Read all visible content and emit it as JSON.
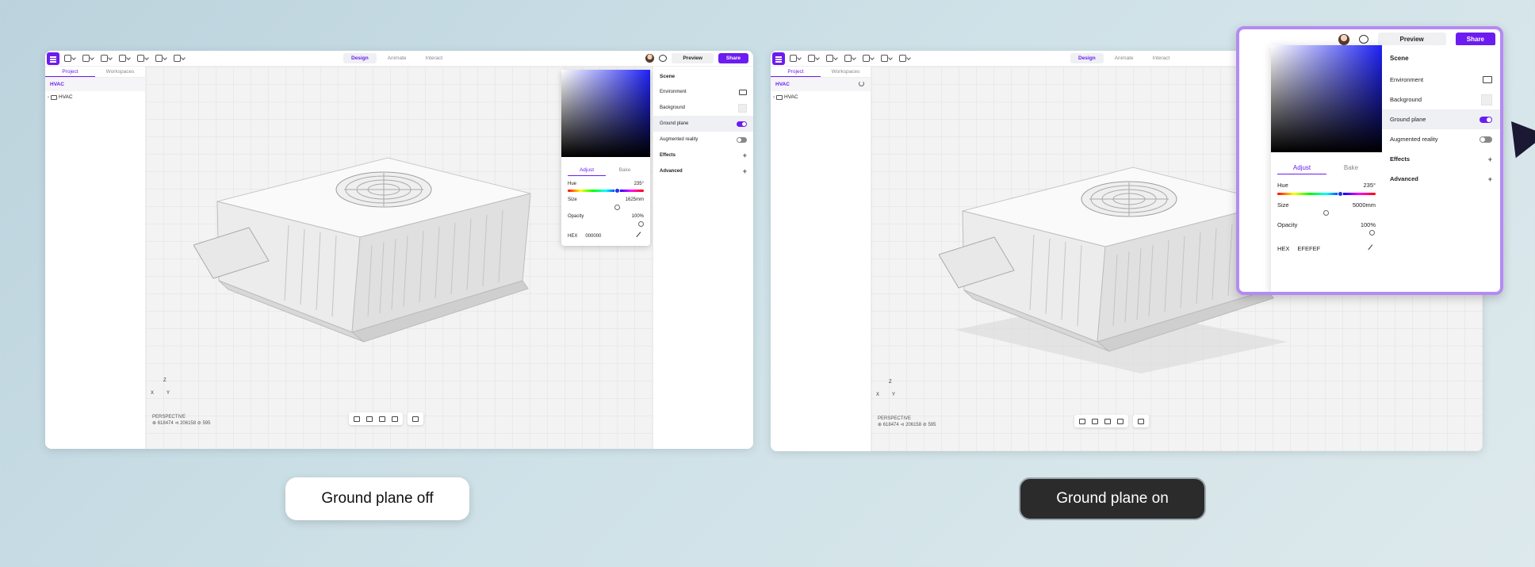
{
  "colors": {
    "accent": "#6c1cf0",
    "zoom_border": "#b48af4",
    "caption_dark": "#2b2b2b"
  },
  "left_window": {
    "toolbar": {
      "modes": [
        "Design",
        "Animate",
        "Interact"
      ],
      "active_mode": "Design",
      "preview_label": "Preview",
      "share_label": "Share"
    },
    "left_panel": {
      "tabs": [
        "Project",
        "Workspaces"
      ],
      "project_name": "HVAC",
      "tree_item": "HVAC"
    },
    "viewport": {
      "axes": {
        "z": "Z",
        "x": "X",
        "y": "Y"
      },
      "camera": "PERSPECTIVE",
      "stats": "⊕ 618474  ⊲ 206158  ⊘ 595"
    },
    "color_picker": {
      "tabs": [
        "Adjust",
        "Bake"
      ],
      "hue_label": "Hue",
      "hue_value": "235°",
      "size_label": "Size",
      "size_value": "1625mm",
      "opacity_label": "Opacity",
      "opacity_value": "100%",
      "format": "HEX",
      "hex_value": "000000"
    },
    "scene_panel": {
      "title": "Scene",
      "environment": "Environment",
      "background": "Background",
      "ground_plane": "Ground plane",
      "ground_plane_on": true,
      "augmented_reality": "Augmented reality",
      "effects": "Effects",
      "advanced": "Advanced"
    }
  },
  "right_window": {
    "toolbar": {
      "modes": [
        "Design",
        "Animate",
        "Interact"
      ],
      "active_mode": "Design"
    },
    "left_panel": {
      "tabs": [
        "Project",
        "Workspaces"
      ],
      "project_name": "HVAC",
      "tree_item": "HVAC"
    },
    "viewport": {
      "axes": {
        "z": "Z",
        "x": "X",
        "y": "Y"
      },
      "camera": "PERSPECTIVE",
      "stats": "⊕ 618474  ⊲ 206158  ⊘ 595"
    }
  },
  "zoom_panel": {
    "preview_label": "Preview",
    "share_label": "Share",
    "color_picker": {
      "tabs": [
        "Adjust",
        "Bake"
      ],
      "hue_label": "Hue",
      "hue_value": "235°",
      "size_label": "Size",
      "size_value": "5000mm",
      "opacity_label": "Opacity",
      "opacity_value": "100%",
      "format": "HEX",
      "hex_value": "EFEFEF"
    },
    "scene_panel": {
      "title": "Scene",
      "environment": "Environment",
      "background": "Background",
      "ground_plane": "Ground plane",
      "ground_plane_on": true,
      "augmented_reality": "Augmented reality",
      "effects": "Effects",
      "advanced": "Advanced"
    }
  },
  "captions": {
    "off": "Ground plane off",
    "on": "Ground plane on"
  }
}
